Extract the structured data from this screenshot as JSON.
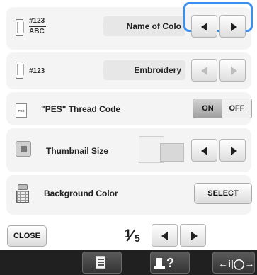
{
  "settings": {
    "thread_number_display": {
      "value": "Name of Colo",
      "thread_label": "#123",
      "thread_sub": "ABC"
    },
    "thread_color_display": {
      "value": "Embroidery",
      "thread_label": "#123"
    },
    "pes_thread_code": {
      "label": "\"PES\" Thread Code",
      "icon_text": "PES",
      "on_label": "ON",
      "off_label": "OFF",
      "state": "ON"
    },
    "thumbnail_size": {
      "label": "Thumbnail Size"
    },
    "background_color": {
      "label": "Background Color",
      "select_label": "SELECT"
    }
  },
  "footer": {
    "close_label": "CLOSE",
    "page_current": "1",
    "page_total": "5"
  },
  "bottom_bar": {
    "help_symbol": "?",
    "connect_symbol": "←i|◯→"
  },
  "colors": {
    "highlight": "#3b8ff0",
    "bottom_bar": "#202020",
    "row_bg": "#f4f4f4"
  }
}
